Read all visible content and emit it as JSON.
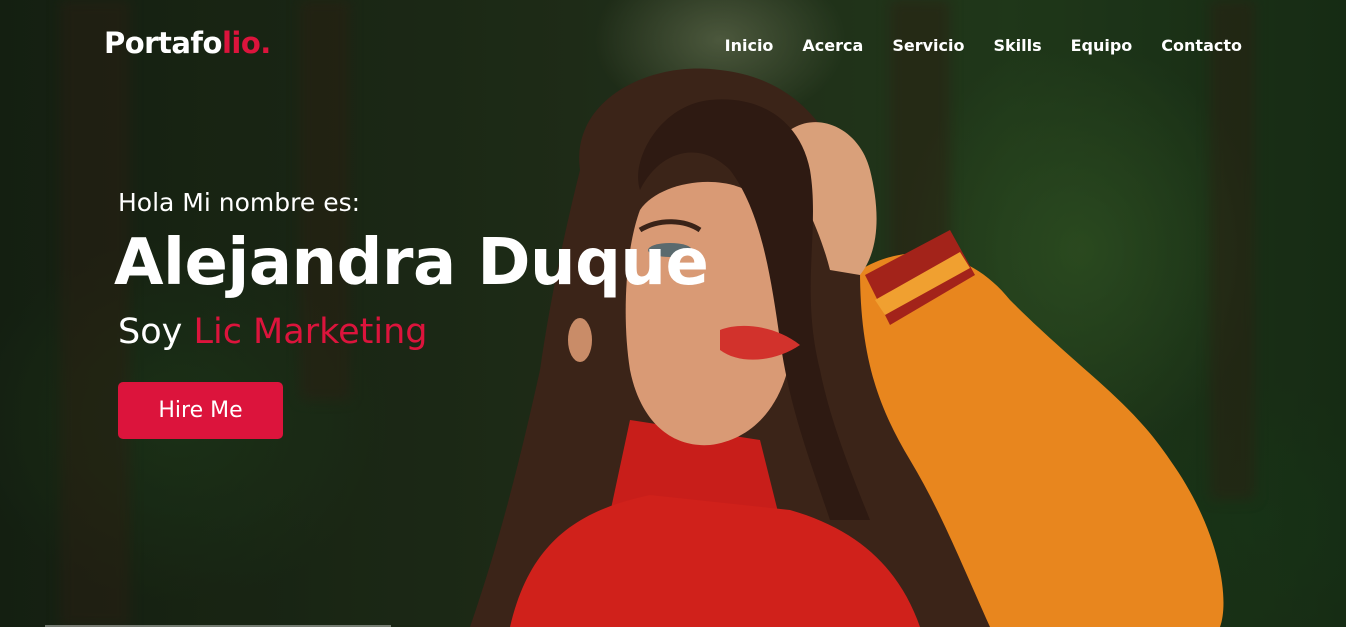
{
  "logo": {
    "main": "Portafo",
    "accent": "lio."
  },
  "nav": {
    "items": [
      "Inicio",
      "Acerca",
      "Servicio",
      "Skills",
      "Equipo",
      "Contacto"
    ]
  },
  "hero": {
    "intro": "Hola Mi nombre es:",
    "name": "Alejandra Duque",
    "role_prefix": "Soy ",
    "role": "Lic Marketing",
    "button_label": "Hire Me"
  },
  "colors": {
    "accent": "#dc143c",
    "text": "#ffffff"
  }
}
